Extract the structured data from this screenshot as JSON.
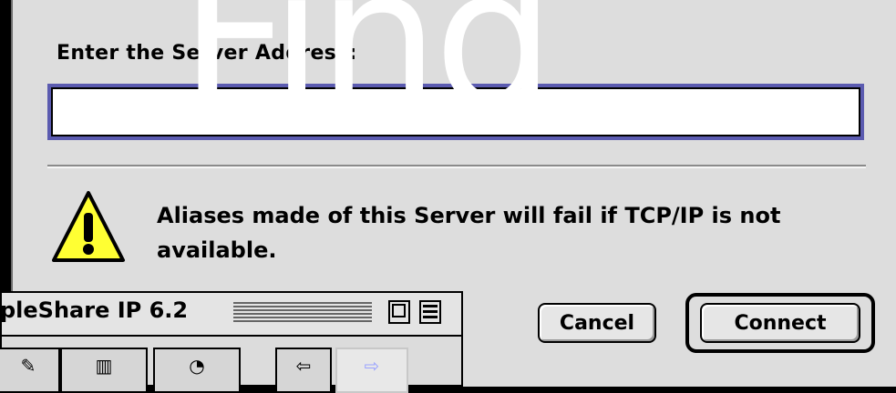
{
  "overlay_title": "Find",
  "dialog": {
    "prompt": "Enter the Server Address:",
    "server_address_value": "",
    "warning_text": "Aliases made of this Server will fail if TCP/IP is not available.",
    "cancel_label": "Cancel",
    "connect_label": "Connect"
  },
  "background_window": {
    "title": "pleShare IP 6.2"
  },
  "colors": {
    "focus_ring": "#5b5bb0",
    "warning_yellow": "#ffff33"
  }
}
